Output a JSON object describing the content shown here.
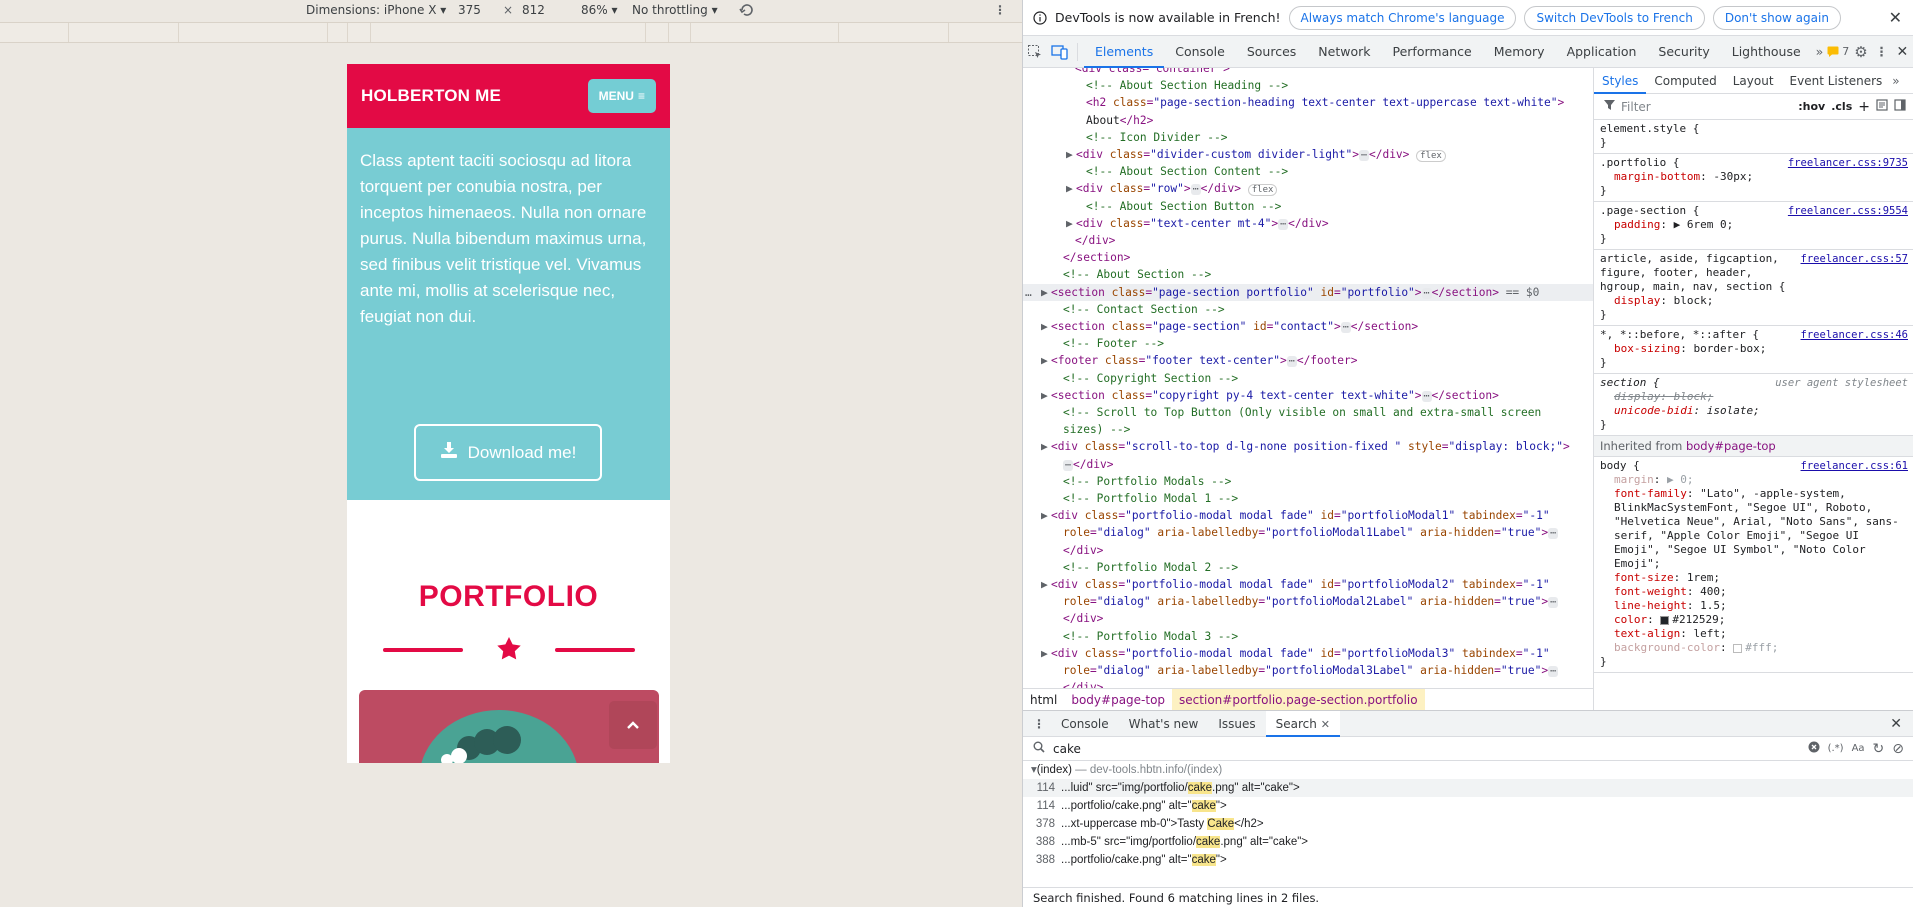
{
  "device_toolbar": {
    "dimensions_label": "Dimensions: iPhone X",
    "width": "375",
    "times": "×",
    "height": "812",
    "zoom": "86%",
    "throttling": "No throttling"
  },
  "site": {
    "brand": "HOLBERTON ME",
    "menu_label": "MENU",
    "about_text": "Class aptent taciti sociosqu ad litora torquent per conubia nostra, per inceptos himenaeos. Nulla non ornare purus. Nulla bibendum maximus urna, sed finibus velit tristique vel. Vivamus ante mi, mollis at scelerisque nec, feugiat non dui.",
    "download_label": "Download me!",
    "portfolio_title": "PORTFOLIO"
  },
  "infobar": {
    "message": "DevTools is now available in French!",
    "btn_match": "Always match Chrome's language",
    "btn_switch": "Switch DevTools to French",
    "btn_dismiss": "Don't show again"
  },
  "tabs": [
    "Elements",
    "Console",
    "Sources",
    "Network",
    "Performance",
    "Memory",
    "Application",
    "Security",
    "Lighthouse"
  ],
  "issues_count": "7",
  "elements": {
    "lines": [
      {
        "t": "<div class=\"container\">"
      },
      {
        "t": "<!-- About Section Heading -->"
      },
      {
        "t": "<h2 class=\"page-section-heading text-center text-uppercase text-white\">"
      },
      {
        "t": "About</h2>"
      },
      {
        "t": "<!-- Icon Divider -->"
      },
      {
        "t": "<div class=\"divider-custom divider-light\">"
      },
      {
        "t": "<!-- About Section Content -->"
      },
      {
        "t": "<div class=\"row\">"
      },
      {
        "t": "<!-- About Section Button -->"
      },
      {
        "t": "<div class=\"text-center mt-4\">"
      },
      {
        "t": "</div>"
      },
      {
        "t": "</section>"
      },
      {
        "t": "<!-- About Section -->"
      },
      {
        "t": "<section class=\"page-section portfolio\" id=\"portfolio\">"
      },
      {
        "t": "<!-- Contact Section -->"
      },
      {
        "t": "<section class=\"page-section\" id=\"contact\">"
      },
      {
        "t": "<!-- Footer -->"
      },
      {
        "t": "<footer class=\"footer text-center\">"
      },
      {
        "t": "<!-- Copyright Section -->"
      },
      {
        "t": "<section class=\"copyright py-4 text-center text-white\">"
      },
      {
        "t": "<!-- Scroll to Top Button (Only visible on small and extra-small screen"
      },
      {
        "t": "sizes) -->"
      },
      {
        "t": "<div class=\"scroll-to-top d-lg-none position-fixed \" style=\"display: block;\">"
      },
      {
        "t": "</div>"
      },
      {
        "t": "<!-- Portfolio Modals -->"
      },
      {
        "t": "<!-- Portfolio Modal 1 -->"
      },
      {
        "t": "<div class=\"portfolio-modal modal fade\" id=\"portfolioModal1\" tabindex=\"-1\""
      },
      {
        "t": "role=\"dialog\" aria-labelledby=\"portfolioModal1Label\" aria-hidden=\"true\">"
      },
      {
        "t": "</div>"
      },
      {
        "t": "<!-- Portfolio Modal 2 -->"
      },
      {
        "t": "<div class=\"portfolio-modal modal fade\" id=\"portfolioModal2\" tabindex=\"-1\""
      },
      {
        "t": "role=\"dialog\" aria-labelledby=\"portfolioModal2Label\" aria-hidden=\"true\">"
      },
      {
        "t": "</div>"
      },
      {
        "t": "<!-- Portfolio Modal 3 -->"
      },
      {
        "t": "<div class=\"portfolio-modal modal fade\" id=\"portfolioModal3\" tabindex=\"-1\""
      },
      {
        "t": "role=\"dialog\" aria-labelledby=\"portfolioModal3Label\" aria-hidden=\"true\">"
      },
      {
        "t": "</div>"
      }
    ],
    "selected_suffix": "== $0",
    "flex_badge": "flex"
  },
  "breadcrumbs": [
    "html",
    "body#page-top",
    "section#portfolio.page-section.portfolio"
  ],
  "styles": {
    "tabs": [
      "Styles",
      "Computed",
      "Layout",
      "Event Listeners"
    ],
    "filter_placeholder": "Filter",
    "hov": ":hov",
    "cls": ".cls",
    "element_style": "element.style {",
    "rules": [
      {
        "selector": ".portfolio {",
        "source": "freelancer.css:9735",
        "props": [
          [
            "margin-bottom",
            "-30px;"
          ]
        ]
      },
      {
        "selector": ".page-section {",
        "source": "freelancer.css:9554",
        "props": [
          [
            "padding",
            "▶ 6rem 0;"
          ]
        ]
      },
      {
        "selector": "article, aside, figcaption, figure, footer, header, hgroup, main, nav, section {",
        "source": "freelancer.css:57",
        "props": [
          [
            "display",
            "block;"
          ]
        ]
      },
      {
        "selector": "*, *::before, *::after {",
        "source": "freelancer.css:46",
        "props": [
          [
            "box-sizing",
            "border-box;"
          ]
        ]
      }
    ],
    "ua_rule": {
      "selector": "section {",
      "source": "user agent stylesheet",
      "props": [
        [
          "display",
          "block;"
        ],
        [
          "unicode-bidi",
          "isolate;"
        ]
      ]
    },
    "inherited_label": "Inherited from",
    "inherited_from": "body#page-top",
    "body_rule": {
      "selector": "body {",
      "source": "freelancer.css:61",
      "props": [
        [
          "margin",
          "▶ 0;"
        ],
        [
          "font-family",
          "\"Lato\", -apple-system, BlinkMacSystemFont, \"Segoe UI\", Roboto, \"Helvetica Neue\", Arial, \"Noto Sans\", sans-serif, \"Apple Color Emoji\", \"Segoe UI Emoji\", \"Segoe UI Symbol\", \"Noto Color Emoji\";"
        ],
        [
          "font-size",
          "1rem;"
        ],
        [
          "font-weight",
          "400;"
        ],
        [
          "line-height",
          "1.5;"
        ],
        [
          "color",
          "#212529;"
        ],
        [
          "text-align",
          "left;"
        ],
        [
          "background-color",
          "#fff;"
        ]
      ]
    }
  },
  "drawer": {
    "tabs": [
      "Console",
      "What's new",
      "Issues",
      "Search"
    ],
    "query": "cake",
    "file_label": "(index)",
    "file_path": "— dev-tools.hbtn.info/(index)",
    "results": [
      {
        "line": "114",
        "before": "...luid\" src=\"img/portfolio/",
        "match": "cake",
        "after": ".png\" alt=\"cake\">"
      },
      {
        "line": "114",
        "before": "...portfolio/cake.png\" alt=\"",
        "match": "cake",
        "after": "\">"
      },
      {
        "line": "378",
        "before": "...xt-uppercase mb-0\">Tasty ",
        "match": "Cake",
        "after": "</h2>"
      },
      {
        "line": "388",
        "before": "...mb-5\" src=\"img/portfolio/",
        "match": "cake",
        "after": ".png\" alt=\"cake\">"
      },
      {
        "line": "388",
        "before": "...portfolio/cake.png\" alt=\"",
        "match": "cake",
        "after": "\">"
      }
    ],
    "status": "Search finished.  Found 6 matching lines in 2 files."
  },
  "colors": {
    "brand_red": "#e30a45",
    "teal": "#78ccd3",
    "devtools_blue": "#1a73e8"
  }
}
